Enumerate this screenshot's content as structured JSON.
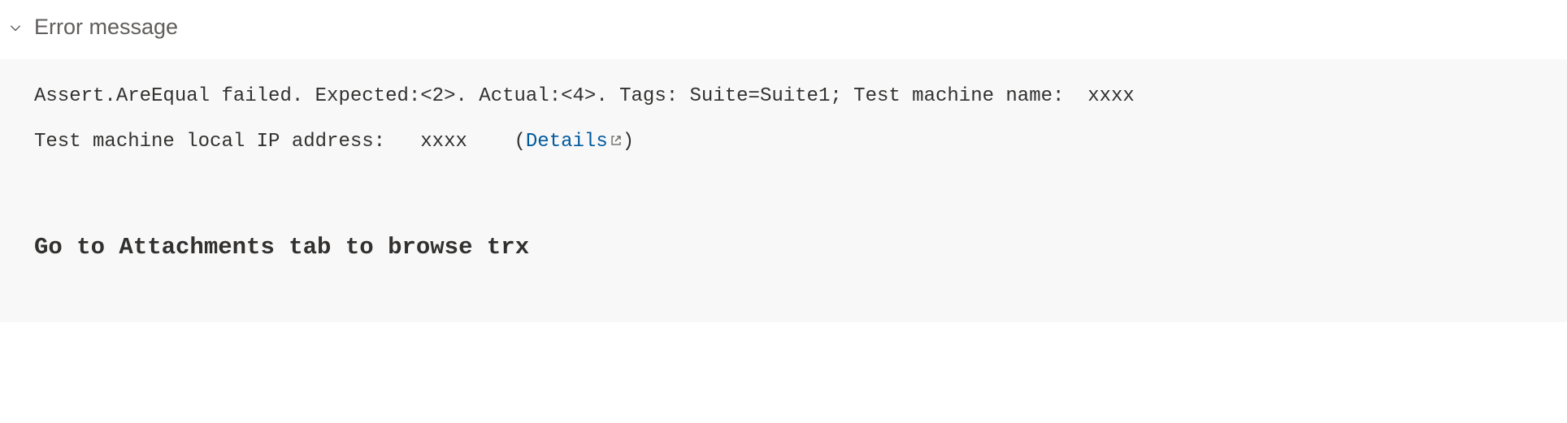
{
  "section": {
    "title": "Error message"
  },
  "error": {
    "line1_part1": "Assert.AreEqual failed. Expected:<2>. Actual:<4>. Tags: Suite=Suite1; Test machine name:  xxxx",
    "line2_part1": "Test machine local IP address:   xxxx    ",
    "paren_open": "(",
    "details_label": "Details",
    "paren_close": ")",
    "attachments_msg": "Go to Attachments tab to browse trx"
  }
}
